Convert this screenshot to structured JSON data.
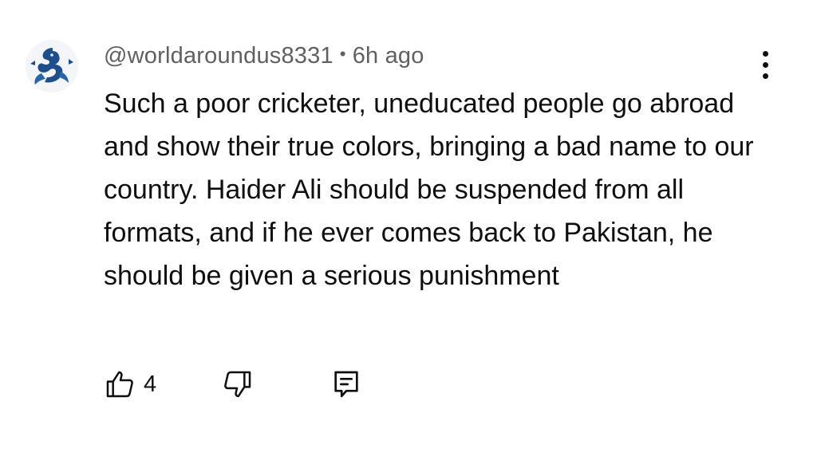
{
  "comment": {
    "author": "@worldaroundus8331",
    "separator": "•",
    "timestamp": "6h ago",
    "text": "Such a poor cricketer, uneducated people go abroad and show their true colors, bringing a bad name to our country. Haider Ali should be suspended from all formats, and if he ever comes back to Pakistan, he should be given a serious punishment",
    "like_count": "4",
    "avatar_icon": "dragon-logo-icon"
  },
  "icons": {
    "more": "more-vertical-icon",
    "like": "thumbs-up-icon",
    "dislike": "thumbs-down-icon",
    "reply": "reply-comment-icon"
  },
  "colors": {
    "text": "#0f0f0f",
    "meta": "#606060",
    "avatar_accent": "#1e4f8c"
  }
}
